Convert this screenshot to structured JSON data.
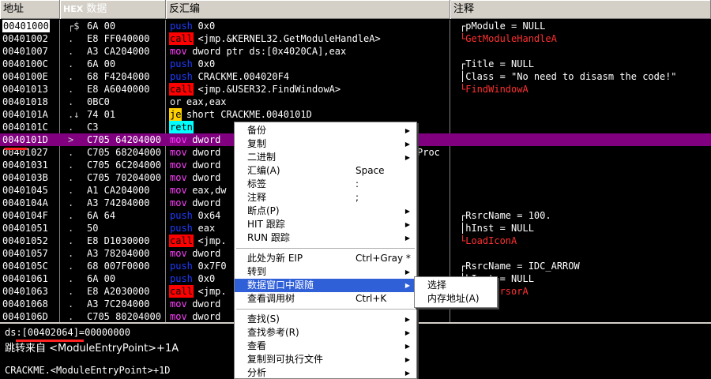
{
  "header": {
    "addr": "地址",
    "hex_tag": "HEX",
    "hex": "数据",
    "disasm": "反汇编",
    "comment": "注释"
  },
  "rows": [
    {
      "addr": "00401000",
      "gut": "┌$",
      "hex": "6A 00",
      "mn": "push",
      "mnc": "push",
      "ops": "0x0",
      "cmt": "┌pModule = NULL",
      "cmtc": "",
      "cur": true
    },
    {
      "addr": "00401002",
      "gut": ".",
      "hex": "E8 FF040000",
      "mn": "call",
      "mnc": "call",
      "ops": "<jmp.&KERNEL32.GetModuleHandleA>",
      "cmt": "└GetModuleHandleA",
      "cmtc": "red"
    },
    {
      "addr": "00401007",
      "gut": ".",
      "hex": "A3 CA204000",
      "mn": "mov",
      "mnc": "mov",
      "ops": "dword ptr ds:[0x4020CA],eax",
      "cmt": ""
    },
    {
      "addr": "0040100C",
      "gut": ".",
      "hex": "6A 00",
      "mn": "push",
      "mnc": "push",
      "ops": "0x0",
      "cmt": "┌Title = NULL"
    },
    {
      "addr": "0040100E",
      "gut": ".",
      "hex": "68 F4204000",
      "mn": "push",
      "mnc": "push",
      "ops": "CRACKME.004020F4",
      "cmt": "│Class = \"No need to disasm the code!\""
    },
    {
      "addr": "00401013",
      "gut": ".",
      "hex": "E8 A6040000",
      "mn": "call",
      "mnc": "call",
      "ops": "<jmp.&USER32.FindWindowA>",
      "cmt": "└FindWindowA",
      "cmtc": "red"
    },
    {
      "addr": "00401018",
      "gut": ".",
      "hex": "0BC0",
      "mn": "or",
      "mnc": "or",
      "ops": "eax,eax",
      "cmt": ""
    },
    {
      "addr": "0040101A",
      "gut": ".↓",
      "hex": "74 01",
      "mn": "je",
      "mnc": "je",
      "ops": "short CRACKME.0040101D",
      "cmt": ""
    },
    {
      "addr": "0040101C",
      "gut": ". ",
      "hex": "C3",
      "mn": "retn",
      "mnc": "retn",
      "ops": "",
      "cmt": ""
    },
    {
      "addr": "0040101D",
      "gut": ">",
      "hex": "C705 64204000",
      "mn": "mov",
      "mnc": "mov",
      "ops": "dword",
      "cmt": "",
      "sel": true
    },
    {
      "addr": "00401027",
      "gut": ".",
      "hex": "C705 68204000",
      "mn": "mov",
      "mnc": "mov",
      "ops": "dword",
      "cmt": "Proc",
      "cmtx": true
    },
    {
      "addr": "00401031",
      "gut": ".",
      "hex": "C705 6C204000",
      "mn": "mov",
      "mnc": "mov",
      "ops": "dword",
      "cmt": ""
    },
    {
      "addr": "0040103B",
      "gut": ".",
      "hex": "C705 70204000",
      "mn": "mov",
      "mnc": "mov",
      "ops": "dword",
      "cmt": ""
    },
    {
      "addr": "00401045",
      "gut": ".",
      "hex": "A1 CA204000",
      "mn": "mov",
      "mnc": "mov",
      "ops": "eax,dw",
      "cmt": ""
    },
    {
      "addr": "0040104A",
      "gut": ".",
      "hex": "A3 74204000",
      "mn": "mov",
      "mnc": "mov",
      "ops": "dword",
      "cmt": ""
    },
    {
      "addr": "0040104F",
      "gut": ".",
      "hex": "6A 64",
      "mn": "push",
      "mnc": "push",
      "ops": "0x64",
      "cmt": "┌RsrcName = 100."
    },
    {
      "addr": "00401051",
      "gut": ".",
      "hex": "50",
      "mn": "push",
      "mnc": "push",
      "ops": "eax",
      "cmt": "│hInst = NULL"
    },
    {
      "addr": "00401052",
      "gut": ".",
      "hex": "E8 D1030000",
      "mn": "call",
      "mnc": "call",
      "ops": "<jmp.",
      "cmt": "└LoadIconA",
      "cmtc": "red"
    },
    {
      "addr": "00401057",
      "gut": ".",
      "hex": "A3 78204000",
      "mn": "mov",
      "mnc": "mov",
      "ops": "dword",
      "cmt": ""
    },
    {
      "addr": "0040105C",
      "gut": ".",
      "hex": "68 007F0000",
      "mn": "push",
      "mnc": "push",
      "ops": "0x7F0",
      "cmt": "┌RsrcName = IDC_ARROW"
    },
    {
      "addr": "00401061",
      "gut": ".",
      "hex": "6A 00",
      "mn": "push",
      "mnc": "push",
      "ops": "0x0",
      "cmt": "│hInst = NULL"
    },
    {
      "addr": "00401063",
      "gut": ".",
      "hex": "E8 A2030000",
      "mn": "call",
      "mnc": "call",
      "ops": "<jmp.",
      "cmt": "└LoadCursorA",
      "cmtc": "red"
    },
    {
      "addr": "00401068",
      "gut": ".",
      "hex": "A3 7C204000",
      "mn": "mov",
      "mnc": "mov",
      "ops": "dword",
      "cmt": ""
    },
    {
      "addr": "0040106D",
      "gut": ".",
      "hex": "C705 80204000",
      "mn": "mov",
      "mnc": "mov",
      "ops": "dword",
      "cmt": ""
    }
  ],
  "info": {
    "line1": "ds:[00402064]=00000000",
    "line2": "跳转来自 <ModuleEntryPoint>+1A",
    "line3": "CRACKME.<ModuleEntryPoint>+1D"
  },
  "menu": {
    "items": [
      {
        "label": "备份",
        "shortcut": "",
        "arrow": "▶"
      },
      {
        "label": "复制",
        "shortcut": "",
        "arrow": "▶"
      },
      {
        "label": "二进制",
        "shortcut": "",
        "arrow": "▶"
      },
      {
        "label": "汇编(A)",
        "shortcut": "Space",
        "arrow": ""
      },
      {
        "label": "标签",
        "shortcut": ":",
        "arrow": ""
      },
      {
        "label": "注释",
        "shortcut": ";",
        "arrow": ""
      },
      {
        "label": "断点(P)",
        "shortcut": "",
        "arrow": "▶"
      },
      {
        "label": "HIT 跟踪",
        "shortcut": "",
        "arrow": "▶"
      },
      {
        "label": "RUN 跟踪",
        "shortcut": "",
        "arrow": "▶"
      },
      {
        "sep": true
      },
      {
        "label": "此处为新 EIP",
        "shortcut": "Ctrl+Gray *",
        "arrow": ""
      },
      {
        "label": "转到",
        "shortcut": "",
        "arrow": "▶"
      },
      {
        "label": "数据窗口中跟随",
        "shortcut": "",
        "arrow": "▶",
        "hl": true
      },
      {
        "label": "查看调用树",
        "shortcut": "Ctrl+K",
        "arrow": ""
      },
      {
        "sep": true
      },
      {
        "label": "查找(S)",
        "shortcut": "",
        "arrow": "▶"
      },
      {
        "label": "查找参考(R)",
        "shortcut": "",
        "arrow": "▶"
      },
      {
        "label": "查看",
        "shortcut": "",
        "arrow": "▶"
      },
      {
        "label": "复制到可执行文件",
        "shortcut": "",
        "arrow": "▶"
      },
      {
        "label": "分析",
        "shortcut": "",
        "arrow": "▶"
      }
    ]
  },
  "submenu": {
    "items": [
      {
        "label": "选择"
      },
      {
        "label": "内存地址(A)"
      }
    ]
  }
}
